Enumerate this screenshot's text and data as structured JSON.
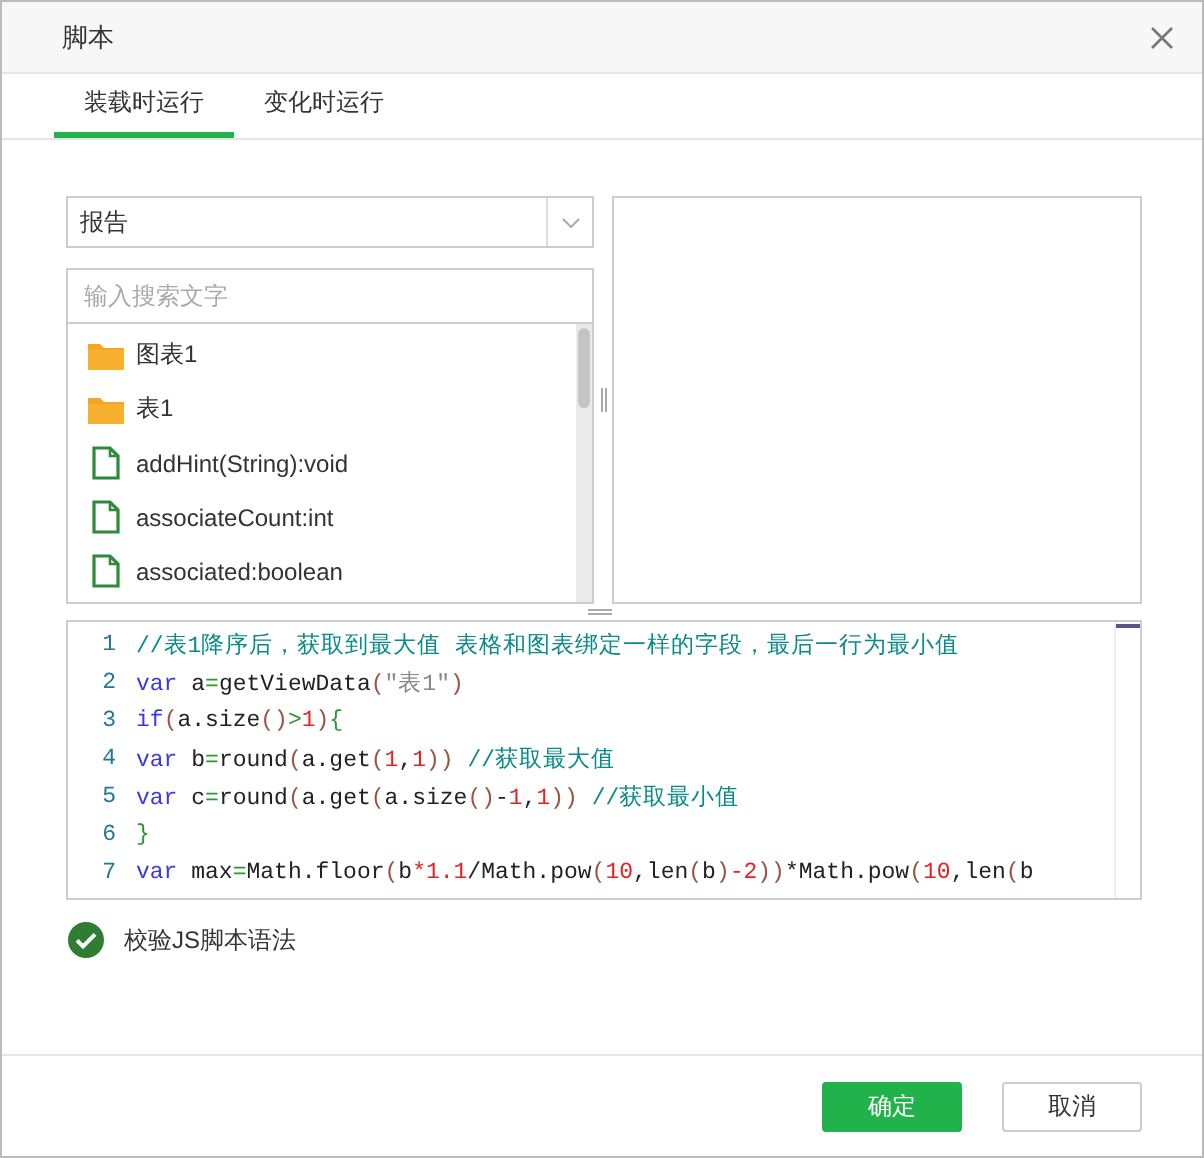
{
  "window": {
    "title": "脚本"
  },
  "tabs": [
    {
      "label": "装载时运行",
      "selected": true
    },
    {
      "label": "变化时运行",
      "selected": false
    }
  ],
  "source_dropdown": {
    "value": "报告"
  },
  "search": {
    "placeholder": "输入搜索文字"
  },
  "tree_items": [
    {
      "kind": "folder",
      "label": "图表1"
    },
    {
      "kind": "folder",
      "label": "表1"
    },
    {
      "kind": "file",
      "label": "addHint(String):void"
    },
    {
      "kind": "file",
      "label": "associateCount:int"
    },
    {
      "kind": "file",
      "label": "associated:boolean"
    }
  ],
  "editor": {
    "lines": [
      {
        "number": "1",
        "tokens": [
          {
            "kind": "comment",
            "text": "//表1降序后，获取到最大值 表格和图表绑定一样的字段，最后一行为最小值"
          }
        ]
      },
      {
        "number": "2",
        "tokens": [
          {
            "kind": "keyword",
            "text": "var"
          },
          {
            "kind": "plain",
            "text": " a"
          },
          {
            "kind": "operator",
            "text": "="
          },
          {
            "kind": "plain",
            "text": "getViewData"
          },
          {
            "kind": "bracket",
            "text": "("
          },
          {
            "kind": "string",
            "text": "\"表1\""
          },
          {
            "kind": "bracket",
            "text": ")"
          }
        ]
      },
      {
        "number": "3",
        "tokens": [
          {
            "kind": "keyword",
            "text": "if"
          },
          {
            "kind": "bracket",
            "text": "("
          },
          {
            "kind": "plain",
            "text": "a.size"
          },
          {
            "kind": "bracket",
            "text": "()"
          },
          {
            "kind": "operator",
            "text": ">"
          },
          {
            "kind": "number",
            "text": "1"
          },
          {
            "kind": "bracket",
            "text": ")"
          },
          {
            "kind": "operator",
            "text": "{"
          }
        ]
      },
      {
        "number": "4",
        "tokens": [
          {
            "kind": "keyword",
            "text": "var"
          },
          {
            "kind": "plain",
            "text": " b"
          },
          {
            "kind": "operator",
            "text": "="
          },
          {
            "kind": "plain",
            "text": "round"
          },
          {
            "kind": "bracket",
            "text": "("
          },
          {
            "kind": "plain",
            "text": "a.get"
          },
          {
            "kind": "bracket",
            "text": "("
          },
          {
            "kind": "number",
            "text": "1"
          },
          {
            "kind": "plain",
            "text": ","
          },
          {
            "kind": "number",
            "text": "1"
          },
          {
            "kind": "bracket",
            "text": "))"
          },
          {
            "kind": "comment",
            "text": " //获取最大值"
          }
        ]
      },
      {
        "number": "5",
        "tokens": [
          {
            "kind": "keyword",
            "text": "var"
          },
          {
            "kind": "plain",
            "text": " c"
          },
          {
            "kind": "operator",
            "text": "="
          },
          {
            "kind": "plain",
            "text": "round"
          },
          {
            "kind": "bracket",
            "text": "("
          },
          {
            "kind": "plain",
            "text": "a.get"
          },
          {
            "kind": "bracket",
            "text": "("
          },
          {
            "kind": "plain",
            "text": "a.size"
          },
          {
            "kind": "bracket",
            "text": "()"
          },
          {
            "kind": "plain",
            "text": "-"
          },
          {
            "kind": "number",
            "text": "1"
          },
          {
            "kind": "plain",
            "text": ","
          },
          {
            "kind": "number",
            "text": "1"
          },
          {
            "kind": "bracket",
            "text": "))"
          },
          {
            "kind": "comment",
            "text": " //获取最小值"
          }
        ]
      },
      {
        "number": "6",
        "tokens": [
          {
            "kind": "operator",
            "text": "}"
          }
        ]
      },
      {
        "number": "7",
        "tokens": [
          {
            "kind": "keyword",
            "text": "var"
          },
          {
            "kind": "plain",
            "text": " max"
          },
          {
            "kind": "operator",
            "text": "="
          },
          {
            "kind": "plain",
            "text": "Math.floor"
          },
          {
            "kind": "bracket",
            "text": "("
          },
          {
            "kind": "plain",
            "text": "b"
          },
          {
            "kind": "number",
            "text": "*1.1"
          },
          {
            "kind": "plain",
            "text": "/Math.pow"
          },
          {
            "kind": "bracket",
            "text": "("
          },
          {
            "kind": "number",
            "text": "10"
          },
          {
            "kind": "plain",
            "text": ",len"
          },
          {
            "kind": "bracket",
            "text": "("
          },
          {
            "kind": "plain",
            "text": "b"
          },
          {
            "kind": "bracket",
            "text": ")"
          },
          {
            "kind": "number",
            "text": "-2"
          },
          {
            "kind": "bracket",
            "text": "))"
          },
          {
            "kind": "plain",
            "text": "*Math.pow"
          },
          {
            "kind": "bracket",
            "text": "("
          },
          {
            "kind": "number",
            "text": "10"
          },
          {
            "kind": "plain",
            "text": ",len"
          },
          {
            "kind": "bracket",
            "text": "("
          },
          {
            "kind": "plain",
            "text": "b"
          }
        ]
      }
    ]
  },
  "validate": {
    "label": "校验JS脚本语法",
    "checked": true
  },
  "buttons": [
    {
      "kind": "primary",
      "label": "确定"
    },
    {
      "kind": "secondary",
      "label": "取消"
    }
  ]
}
